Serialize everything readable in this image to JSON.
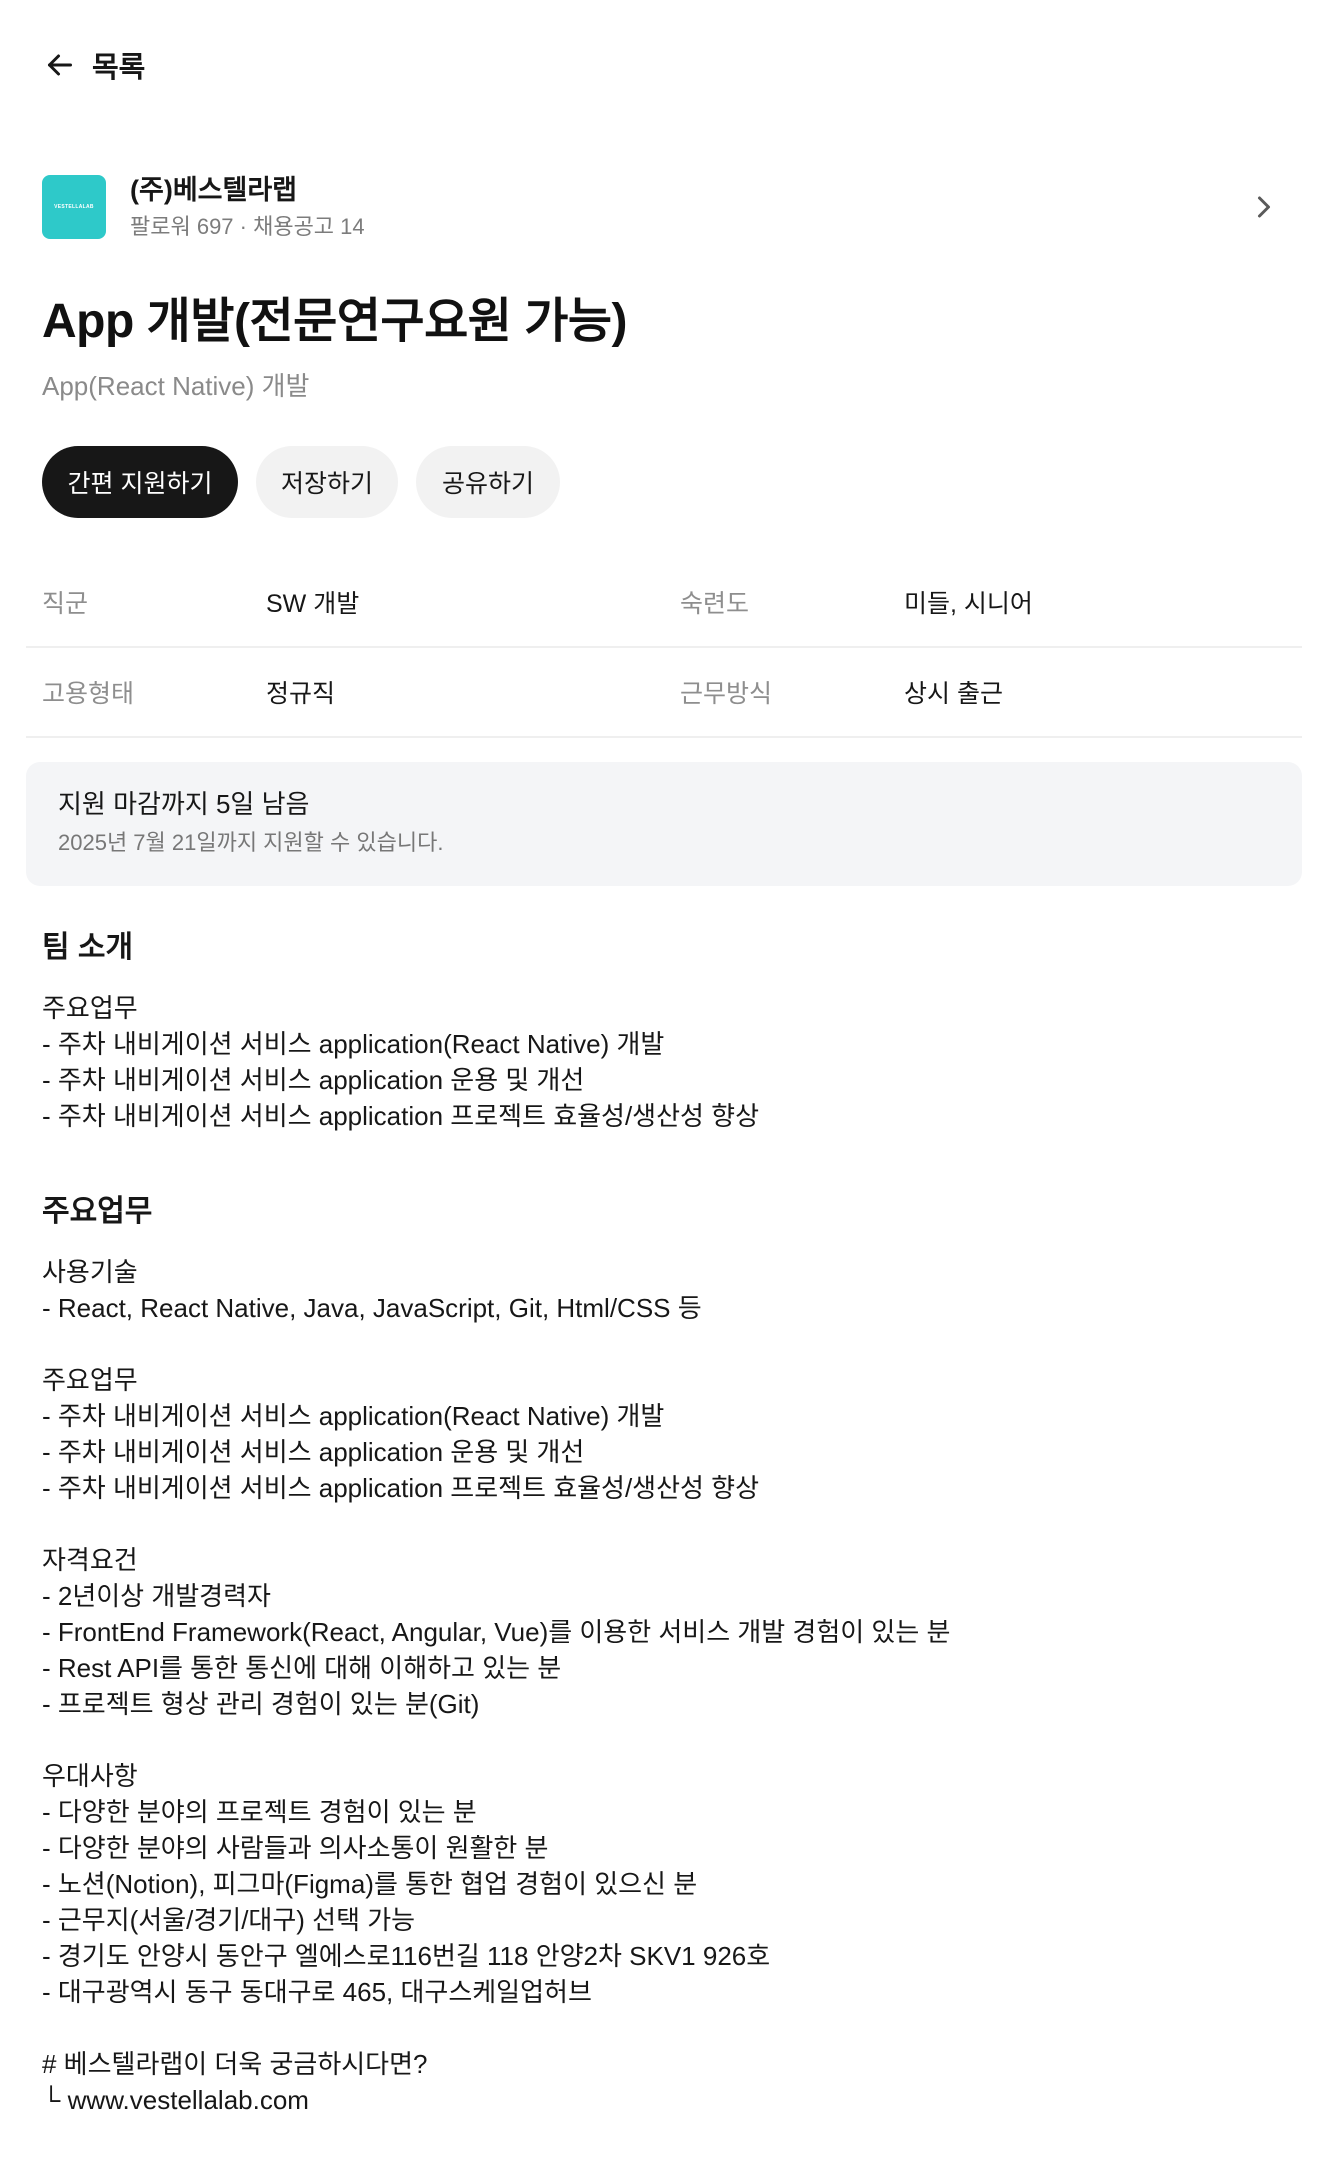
{
  "nav": {
    "back_label": "목록",
    "back_icon": "arrow-left-icon"
  },
  "company": {
    "logo_text": "VESTELLALAB",
    "logo_color": "#2ec9c9",
    "name": "(주)베스텔라랩",
    "meta": "팔로워 697 · 채용공고 14",
    "chevron_icon": "chevron-right-icon"
  },
  "job": {
    "title": "App 개발(전문연구요원 가능)",
    "subtitle": "App(React Native) 개발"
  },
  "actions": {
    "apply_label": "간편 지원하기",
    "save_label": "저장하기",
    "share_label": "공유하기"
  },
  "info": {
    "row1": {
      "k1": "직군",
      "v1": "SW 개발",
      "k2": "숙련도",
      "v2": "미들, 시니어"
    },
    "row2": {
      "k1": "고용형태",
      "v1": "정규직",
      "k2": "근무방식",
      "v2": "상시 출근"
    }
  },
  "deadline": {
    "title": "지원 마감까지 5일 남음",
    "subtitle": "2025년 7월 21일까지 지원할 수 있습니다."
  },
  "team": {
    "heading": "팀 소개",
    "body": "주요업무\n- 주차 내비게이션 서비스 application(React Native) 개발\n- 주차 내비게이션 서비스 application 운용 및 개선\n- 주차 내비게이션 서비스 application 프로젝트 효율성/생산성 향상"
  },
  "duties": {
    "heading": "주요업무",
    "body": "사용기술\n- React, React Native, Java, JavaScript, Git, Html/CSS 등\n\n주요업무\n- 주차 내비게이션 서비스 application(React Native) 개발\n- 주차 내비게이션 서비스 application 운용 및 개선\n- 주차 내비게이션 서비스 application 프로젝트 효율성/생산성 향상\n\n자격요건\n- 2년이상 개발경력자\n- FrontEnd Framework(React, Angular, Vue)를 이용한 서비스 개발 경험이 있는 분\n- Rest API를 통한 통신에 대해 이해하고 있는 분\n- 프로젝트 형상 관리 경험이 있는 분(Git)\n\n우대사항\n- 다양한 분야의 프로젝트 경험이 있는 분\n- 다양한 분야의 사람들과 의사소통이 원활한 분\n- 노션(Notion), 피그마(Figma)를 통한 협업 경험이 있으신 분\n- 근무지(서울/경기/대구) 선택 가능\n- 경기도 안양시 동안구 엘에스로116번길 118 안양2차 SKV1 926호\n- 대구광역시 동구 동대구로 465, 대구스케일업허브\n\n# 베스텔라랩이 더욱 궁금하시다면?\n└ www.vestellalab.com"
  }
}
